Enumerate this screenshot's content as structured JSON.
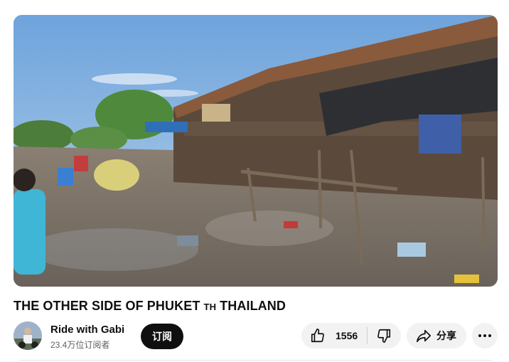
{
  "video": {
    "title_main": "THE OTHER SIDE OF PHUKET",
    "title_flag": "TH",
    "title_end": "THAILAND"
  },
  "channel": {
    "name": "Ride with Gabi",
    "subscribers": "23.4万位订阅者",
    "subscribe_label": "订阅"
  },
  "actions": {
    "like_count": "1556",
    "share_label": "分享"
  },
  "icons": {
    "like": "thumbs-up-icon",
    "dislike": "thumbs-down-icon",
    "share": "share-arrow-icon",
    "more": "more-horizontal-icon"
  },
  "colors": {
    "subscribe_bg": "#0f0f0f",
    "pill_bg": "#f2f2f2",
    "text_primary": "#0f0f0f",
    "text_secondary": "#606060"
  }
}
